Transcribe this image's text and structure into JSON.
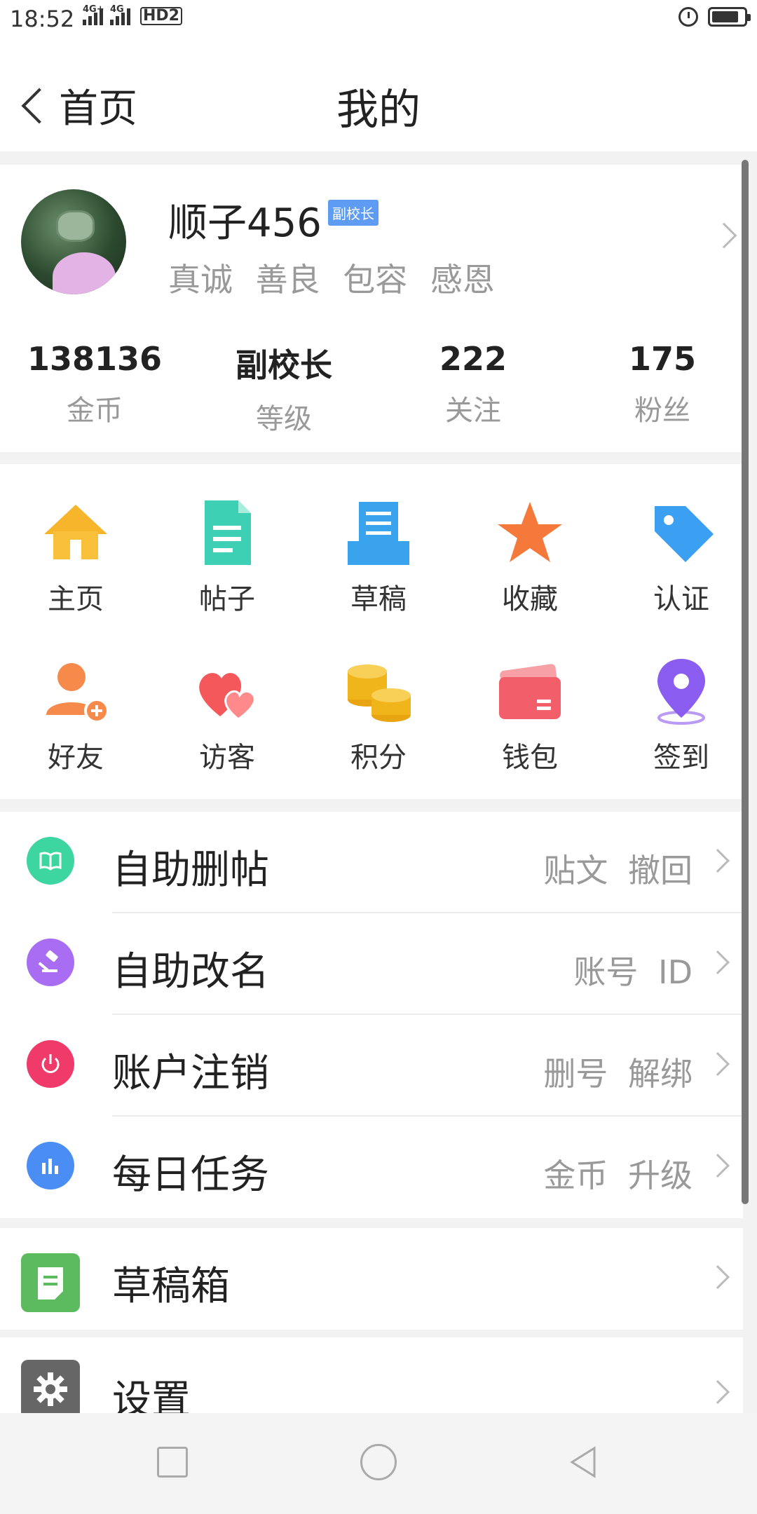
{
  "status_bar": {
    "time": "18:52",
    "network_1": "4G+",
    "network_2": "4G",
    "hd": "HD2",
    "battery_level": 0.85
  },
  "header": {
    "back_label": "首页",
    "title": "我的"
  },
  "profile": {
    "username": "顺子456",
    "badge": "副校长",
    "motto": "真诚 善良 包容 感恩",
    "stats": [
      {
        "value": "138136",
        "label": "金币"
      },
      {
        "value": "副校长",
        "label": "等级"
      },
      {
        "value": "222",
        "label": "关注"
      },
      {
        "value": "175",
        "label": "粉丝"
      }
    ]
  },
  "grid": {
    "items": [
      {
        "label": "主页",
        "icon": "home-icon",
        "color": "#f7b52c"
      },
      {
        "label": "帖子",
        "icon": "document-icon",
        "color": "#3ed0b4"
      },
      {
        "label": "草稿",
        "icon": "draft-tray-icon",
        "color": "#3aa3ee"
      },
      {
        "label": "收藏",
        "icon": "star-icon",
        "color": "#f5793a"
      },
      {
        "label": "认证",
        "icon": "tag-icon",
        "color": "#3b9ff2"
      },
      {
        "label": "好友",
        "icon": "add-friend-icon",
        "color": "#f68a4b"
      },
      {
        "label": "访客",
        "icon": "hearts-icon",
        "color": "#f4585a"
      },
      {
        "label": "积分",
        "icon": "coins-icon",
        "color": "#f1b51c"
      },
      {
        "label": "钱包",
        "icon": "wallet-icon",
        "color": "#f25f6a"
      },
      {
        "label": "签到",
        "icon": "location-pin-icon",
        "color": "#8a5cf0"
      }
    ]
  },
  "list": {
    "items": [
      {
        "label": "自助删帖",
        "sub": "贴文 撤回",
        "icon": "book-icon",
        "color": "#3dd5a0"
      },
      {
        "label": "自助改名",
        "sub": "账号 ID",
        "icon": "gavel-icon",
        "color": "#a86df2"
      },
      {
        "label": "账户注销",
        "sub": "删号 解绑",
        "icon": "power-icon",
        "color": "#f03a6a"
      },
      {
        "label": "每日任务",
        "sub": "金币 升级",
        "icon": "bar-chart-icon",
        "color": "#4a8ef5"
      }
    ]
  },
  "drafts": {
    "label": "草稿箱",
    "icon": "note-icon",
    "color": "#5cbb5e"
  },
  "settings": {
    "label": "设置",
    "icon": "gear-icon",
    "color": "#666666"
  },
  "nav": {
    "recent": "square-icon",
    "home": "circle-icon",
    "back": "triangle-back-icon"
  }
}
